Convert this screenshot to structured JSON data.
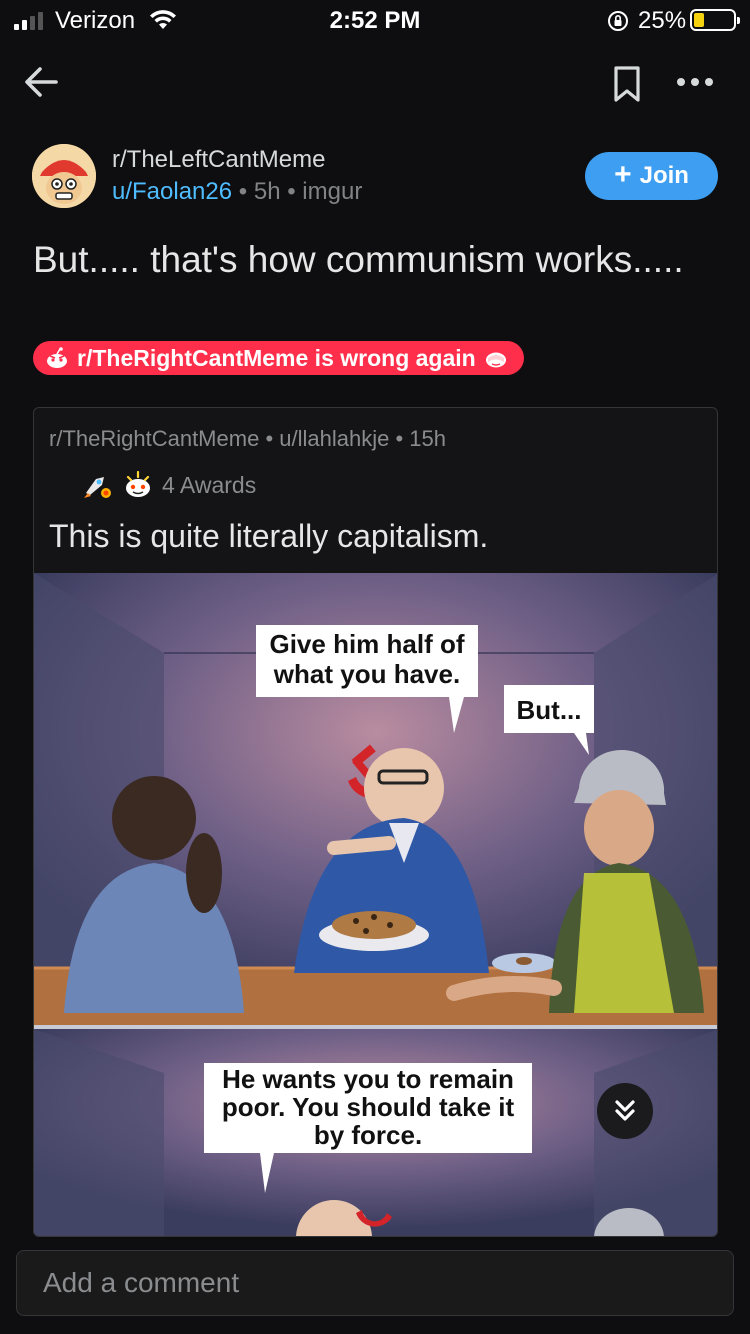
{
  "status_bar": {
    "carrier": "Verizon",
    "time": "2:52 PM",
    "battery_percent": "25%",
    "signal_bars": 2,
    "battery_level": 0.25,
    "battery_color": "#f5d40f"
  },
  "nav": {
    "back_icon": "arrow-left-icon",
    "bookmark_icon": "bookmark-icon",
    "more_icon": "more-horizontal-icon"
  },
  "post": {
    "subreddit": "r/TheLeftCantMeme",
    "author": "u/Faolan26",
    "age": "5h",
    "source": "imgur",
    "separator": "•",
    "join_label": "Join",
    "title": "But..... that's how communism works.....",
    "flair": "r/TheRightCantMeme is wrong again",
    "flair_color": "#ff2e4b"
  },
  "crosspost": {
    "subreddit": "r/TheRightCantMeme",
    "author": "u/llahlahkje",
    "age": "15h",
    "awards_label": "4 Awards",
    "title": "This is quite literally capitalism.",
    "image": {
      "bubble_1": "Give him half of what you have.",
      "bubble_2": "But...",
      "bubble_3": "He wants you to remain poor. You should take it by force."
    }
  },
  "comment": {
    "placeholder": "Add a comment"
  },
  "colors": {
    "background": "#0e0e10",
    "accent": "#3d9ef2",
    "username": "#4fbcff"
  }
}
